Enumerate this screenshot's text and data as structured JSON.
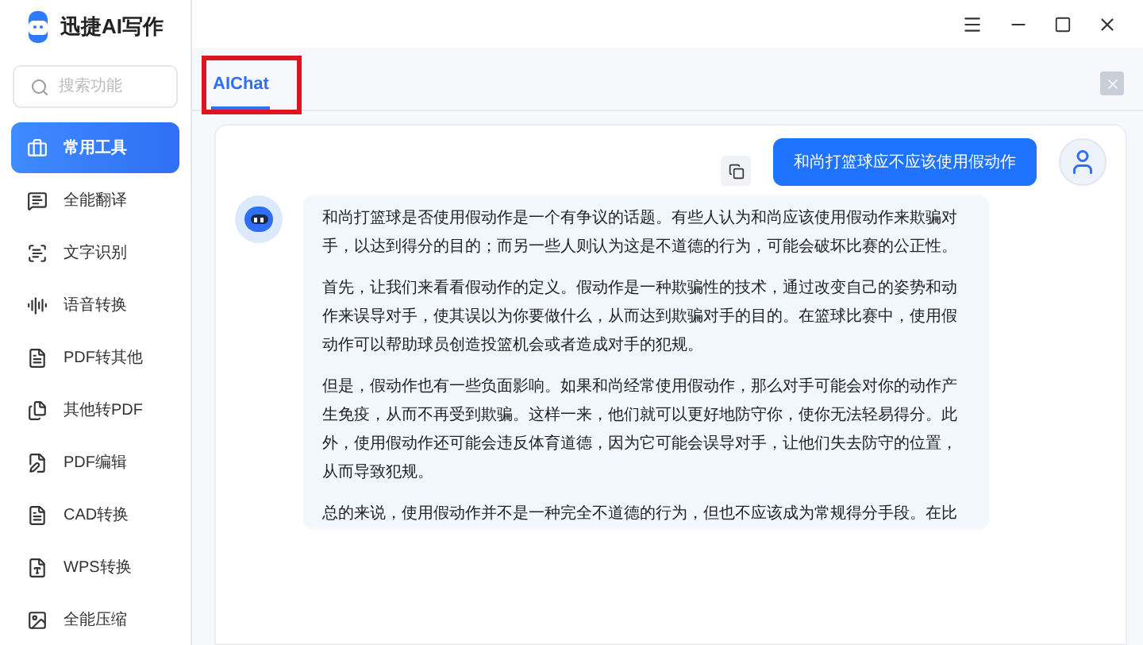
{
  "app": {
    "title": "迅捷AI写作"
  },
  "search": {
    "placeholder": "搜索功能"
  },
  "sidebar": {
    "items": [
      {
        "label": "常用工具",
        "selected": true
      },
      {
        "label": "全能翻译",
        "selected": false
      },
      {
        "label": "文字识别",
        "selected": false
      },
      {
        "label": "语音转换",
        "selected": false
      },
      {
        "label": "PDF转其他",
        "selected": false
      },
      {
        "label": "其他转PDF",
        "selected": false
      },
      {
        "label": "PDF编辑",
        "selected": false
      },
      {
        "label": "CAD转换",
        "selected": false
      },
      {
        "label": "WPS转换",
        "selected": false
      },
      {
        "label": "全能压缩",
        "selected": false
      }
    ]
  },
  "tabs": [
    {
      "label": "AIChat",
      "selected": true,
      "highlighted": true
    }
  ],
  "chat": {
    "messages": [
      {
        "kind": "user",
        "text": "和尚打篮球应不应该使用假动作"
      },
      {
        "kind": "bot",
        "paragraphs": [
          "和尚打篮球是否使用假动作是一个有争议的话题。有些人认为和尚应该使用假动作来欺骗对手，以达到得分的目的；而另一些人则认为这是不道德的行为，可能会破坏比赛的公正性。",
          "首先，让我们来看看假动作的定义。假动作是一种欺骗性的技术，通过改变自己的姿势和动作来误导对手，使其误以为你要做什么，从而达到欺骗对手的目的。在篮球比赛中，使用假动作可以帮助球员创造投篮机会或者造成对手的犯规。",
          "但是，假动作也有一些负面影响。如果和尚经常使用假动作，那么对手可能会对你的动作产生免疫，从而不再受到欺骗。这样一来，他们就可以更好地防守你，使你无法轻易得分。此外，使用假动作还可能会违反体育道德，因为它可能会误导对手，让他们失去防守的位置，从而导致犯规。",
          "总的来说，使用假动作并不是一种完全不道德的行为，但也不应该成为常规得分手段。在比"
        ]
      }
    ]
  }
}
